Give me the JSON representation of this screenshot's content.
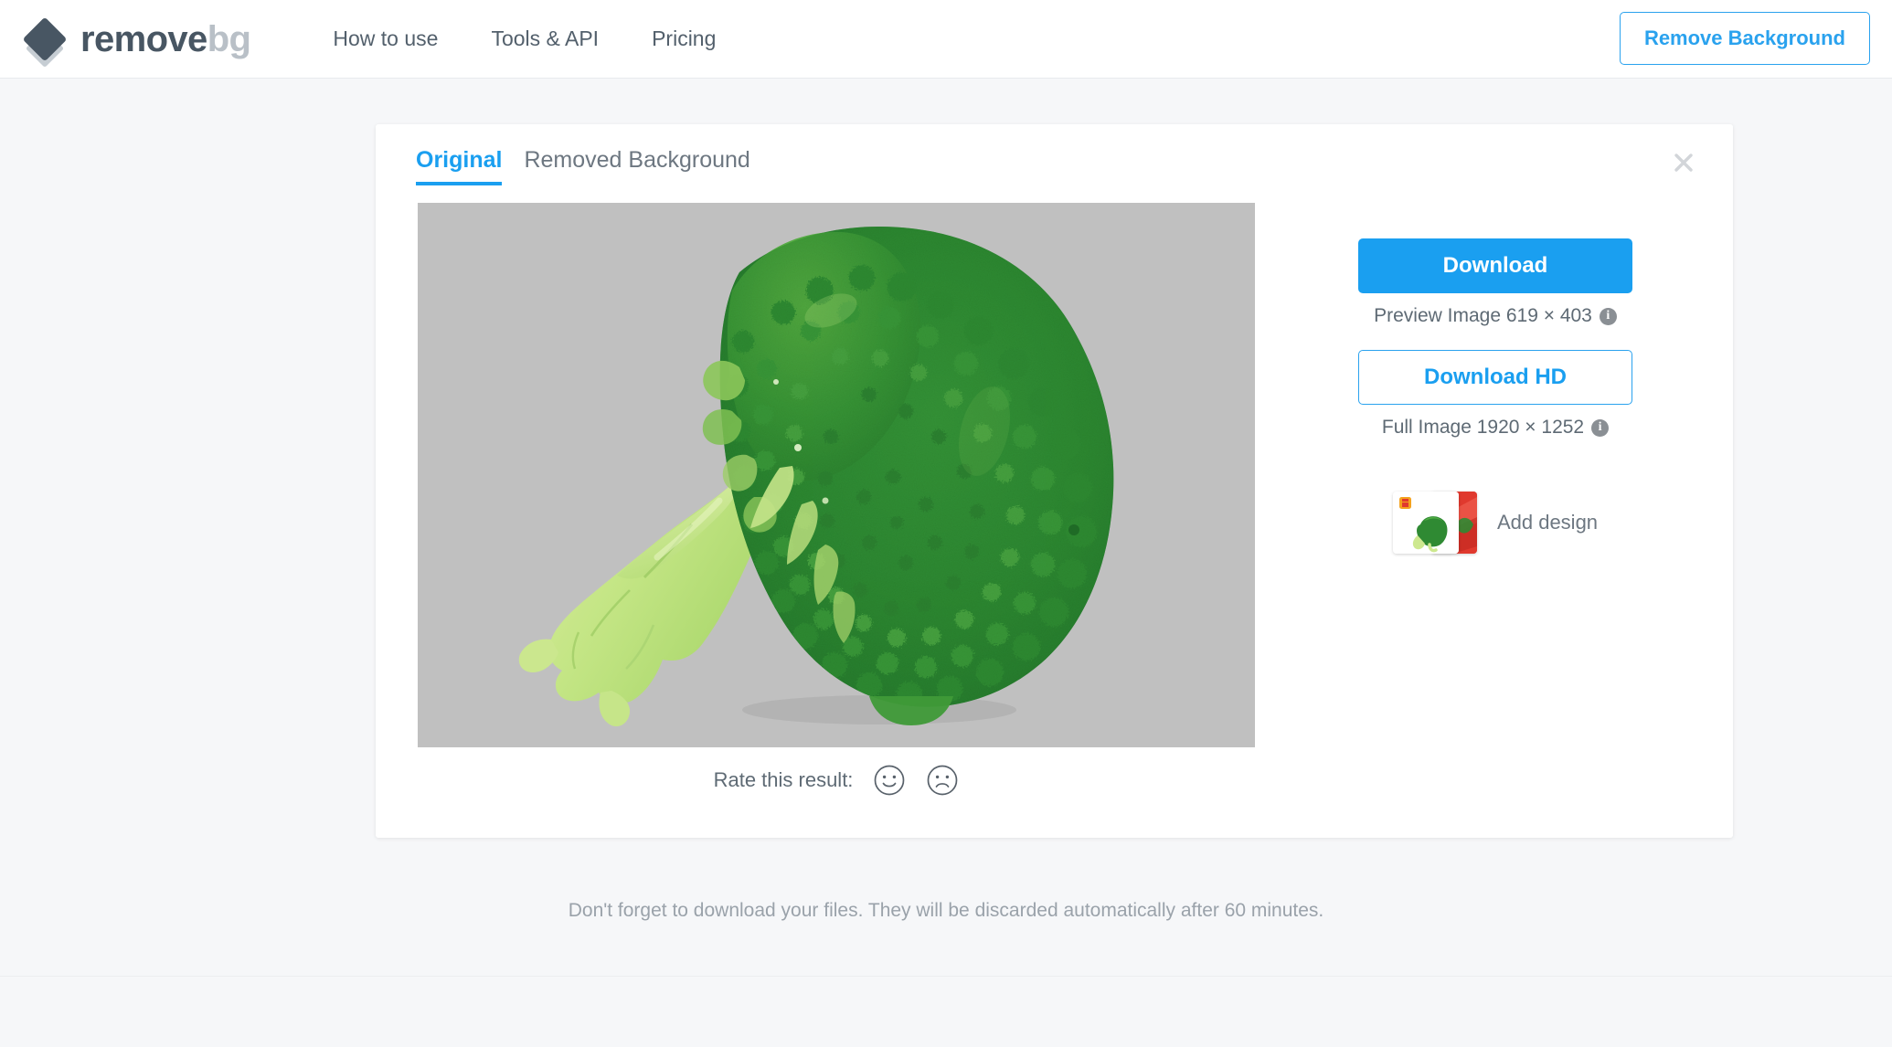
{
  "header": {
    "logo": {
      "icon": "layers-diamond-icon",
      "text_dark": "remove",
      "text_light": "bg"
    },
    "nav": [
      {
        "label": "How to use"
      },
      {
        "label": "Tools & API"
      },
      {
        "label": "Pricing"
      }
    ],
    "cta_label": "Remove Background"
  },
  "card": {
    "tabs": [
      {
        "label": "Original",
        "active": true
      },
      {
        "label": "Removed Background",
        "active": false
      }
    ],
    "close_icon": "close-icon",
    "preview": {
      "alt": "broccoli-photo",
      "background_color": "#c0c0c0"
    },
    "rate": {
      "label": "Rate this result:",
      "positive_icon": "smiley-face-icon",
      "negative_icon": "frowny-face-icon"
    },
    "actions": {
      "download_label": "Download",
      "download_caption": "Preview Image 619 × 403",
      "download_hd_label": "Download HD",
      "download_hd_caption": "Full Image 1920 × 1252",
      "info_icon": "info-icon",
      "info_glyph": "i",
      "add_design_label": "Add design",
      "add_design_icon": "design-templates-thumbnail"
    }
  },
  "footer": {
    "note": "Don't forget to download your files. They will be discarded automatically after 60 minutes."
  },
  "colors": {
    "accent": "#1a9ff0",
    "accent_border": "#2aa2ee",
    "page_bg": "#f6f7f9",
    "logo_dark": "#485663",
    "logo_light": "#b9c0c7",
    "text": "#53606c",
    "muted": "#9aa2aa"
  }
}
